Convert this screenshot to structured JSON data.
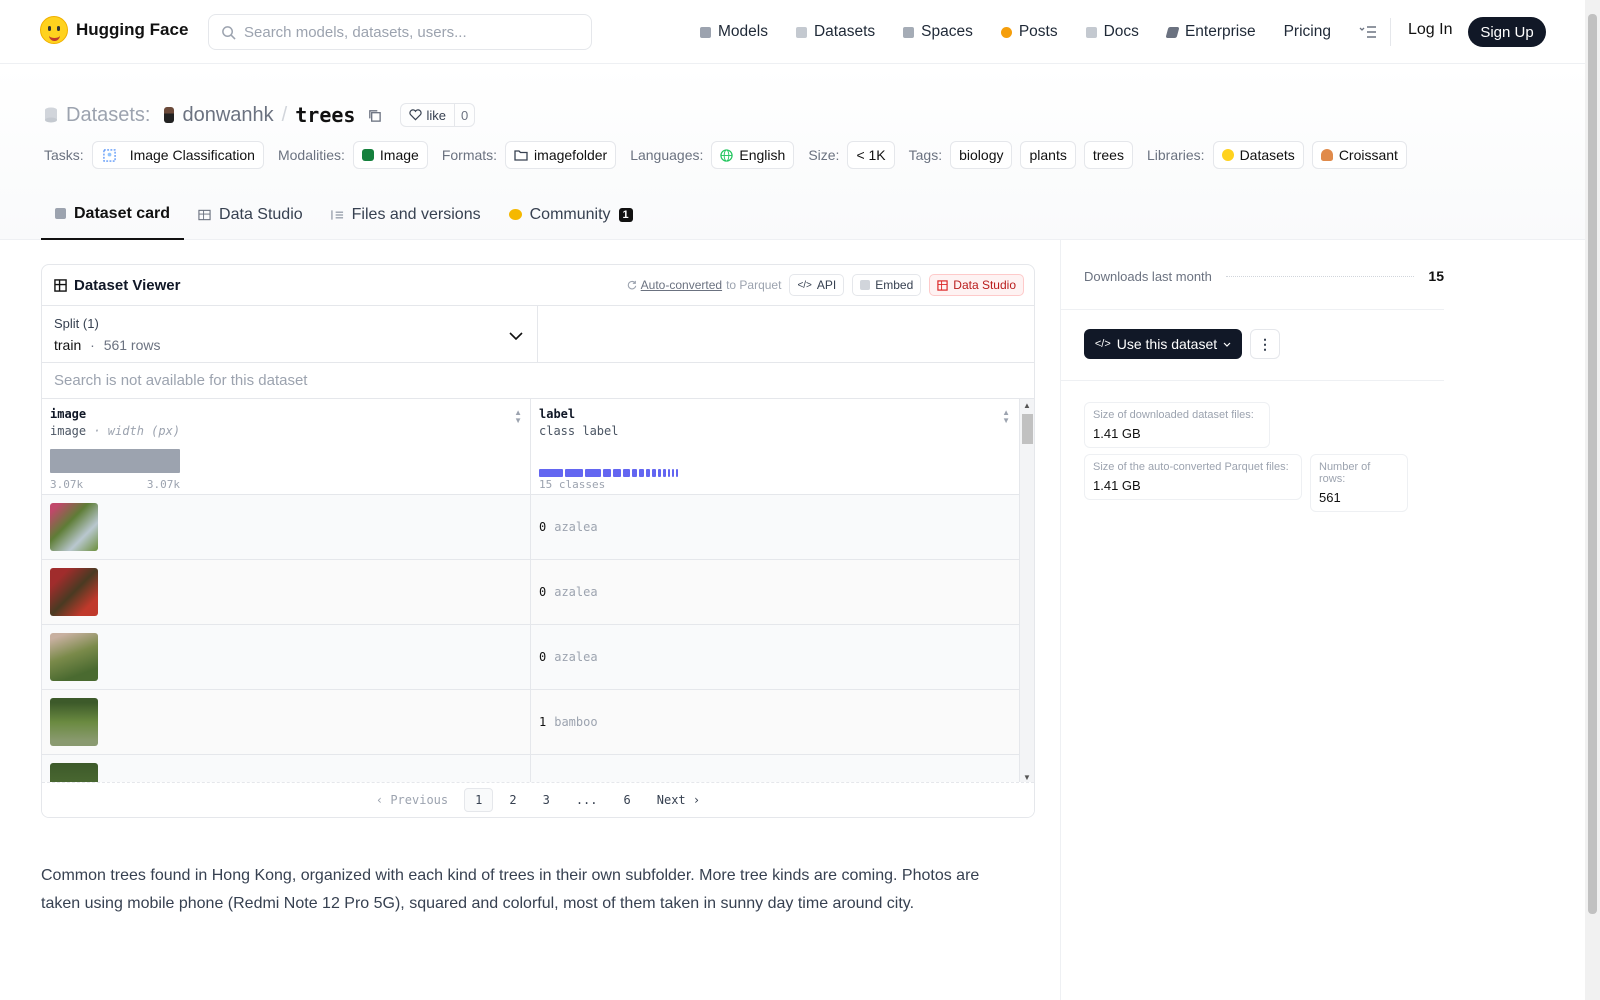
{
  "nav": {
    "brand": "Hugging Face",
    "search_placeholder": "Search models, datasets, users...",
    "links": [
      {
        "label": "Models",
        "icon": "models-icon",
        "color": "#9ca3af"
      },
      {
        "label": "Datasets",
        "icon": "datasets-icon",
        "color": "#9ca3af"
      },
      {
        "label": "Spaces",
        "icon": "spaces-icon",
        "color": "#9ca3af"
      },
      {
        "label": "Posts",
        "icon": "posts-icon",
        "color": "#f59e0b"
      },
      {
        "label": "Docs",
        "icon": "docs-icon",
        "color": "#9ca3af"
      },
      {
        "label": "Enterprise",
        "icon": "enterprise-icon",
        "color": "#6b7280"
      },
      {
        "label": "Pricing",
        "icon": "",
        "color": ""
      }
    ],
    "login": "Log In",
    "signup": "Sign Up"
  },
  "header": {
    "section": "Datasets:",
    "owner": "donwanhk",
    "separator": "/",
    "name": "trees",
    "like_label": "like",
    "like_count": "0",
    "tags": {
      "tasks_key": "Tasks:",
      "tasks_value": "Image Classification",
      "modalities_key": "Modalities:",
      "modalities_value": "Image",
      "formats_key": "Formats:",
      "formats_value": "imagefolder",
      "languages_key": "Languages:",
      "languages_value": "English",
      "size_key": "Size:",
      "size_value": "< 1K",
      "tags_key": "Tags:",
      "tag1": "biology",
      "tag2": "plants",
      "tag3": "trees",
      "libraries_key": "Libraries:",
      "lib1": "Datasets",
      "lib2": "Croissant"
    },
    "tabs": {
      "card": "Dataset card",
      "studio": "Data Studio",
      "files": "Files and versions",
      "community": "Community",
      "community_count": "1"
    }
  },
  "viewer": {
    "title": "Dataset Viewer",
    "auto_converted": "Auto-converted",
    "to_parquet": "to Parquet",
    "api": "API",
    "embed": "Embed",
    "data_studio": "Data Studio",
    "split_label": "Split (1)",
    "split_name": "train",
    "split_dot": "·",
    "split_rows": "561 rows",
    "search_placeholder": "Search is not available for this dataset",
    "columns": {
      "image_name": "image",
      "image_type": "image",
      "image_subtype": "· width (px)",
      "image_min": "3.07k",
      "image_max": "3.07k",
      "label_name": "label",
      "label_type": "class label",
      "label_classes": "15 classes"
    },
    "rows": [
      {
        "idx": "0",
        "label": "azalea",
        "thumb": "#6b8f3a"
      },
      {
        "idx": "0",
        "label": "azalea",
        "thumb": "#7a2a2a"
      },
      {
        "idx": "0",
        "label": "azalea",
        "thumb": "#8a6a4a"
      },
      {
        "idx": "1",
        "label": "bamboo",
        "thumb": "#4a6a30"
      },
      {
        "idx": "",
        "label": "",
        "thumb": "#3d5a2a"
      }
    ],
    "pager": {
      "prev": "Previous",
      "p1": "1",
      "p2": "2",
      "p3": "3",
      "ellipsis": "...",
      "p6": "6",
      "next": "Next"
    }
  },
  "description": "Common trees found in Hong Kong, organized with each kind of trees in their own subfolder. More tree kinds are coming. Photos are taken using mobile phone (Redmi Note 12 Pro 5G), squared and colorful, most of them taken in sunny day time around city.",
  "sidebar": {
    "downloads_label": "Downloads last month",
    "downloads_value": "15",
    "use_button": "Use this dataset",
    "dl_size_label": "Size of downloaded dataset files:",
    "dl_size_value": "1.41 GB",
    "parquet_size_label": "Size of the auto-converted Parquet files:",
    "parquet_size_value": "1.41 GB",
    "rows_label": "Number of rows:",
    "rows_value": "561"
  },
  "colors": {
    "accent_dark": "#111827",
    "class_bar": "#6366f1",
    "brand_yellow": "#ffd21e"
  }
}
